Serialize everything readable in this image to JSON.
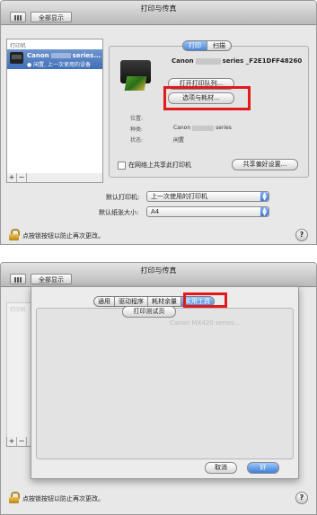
{
  "window_title": "打印与传真",
  "toolbar": {
    "show_all_label": "全部显示"
  },
  "sidebar": {
    "header": "打印机",
    "items": [
      {
        "name_prefix": "Canon",
        "name_suffix": "series...",
        "subtitle": "● 闲置, 上一次使用的设备"
      }
    ]
  },
  "tabs_top": [
    "打印",
    "扫描"
  ],
  "printer": {
    "model_prefix": "Canon",
    "model_suffix": "series _F2E1DFF48260",
    "open_queue_button": "打开打印队列...",
    "options_supplies_button": "选项与耗材...",
    "info": [
      {
        "label": "位置:",
        "value_prefix": "",
        "value_suffix": ""
      },
      {
        "label": "种类:",
        "value_prefix": "Canon",
        "value_suffix": "series"
      },
      {
        "label": "状态:",
        "value_prefix": "闲置",
        "value_suffix": ""
      }
    ]
  },
  "share_checkbox_label": "在网络上共享此打印机",
  "share_prefs_button": "共享偏好设置...",
  "default_printer": {
    "label": "默认打印机:",
    "value": "上一次使用的打印机"
  },
  "default_paper": {
    "label": "默认纸张大小:",
    "value": "A4"
  },
  "lock_text": "点按锁按钮以防止再次更改。",
  "help_symbol": "?",
  "sheet": {
    "tabs": [
      "通用",
      "驱动程序",
      "耗材余量",
      "实用工具"
    ],
    "selected_tab": "实用工具",
    "print_test_button": "打印测试页",
    "background_model_text": "Canon MX420 series...",
    "cancel_button": "取消",
    "ok_button": "好"
  },
  "colors": {
    "highlight": "#e21a1a",
    "selection": "#3e6fb8"
  }
}
